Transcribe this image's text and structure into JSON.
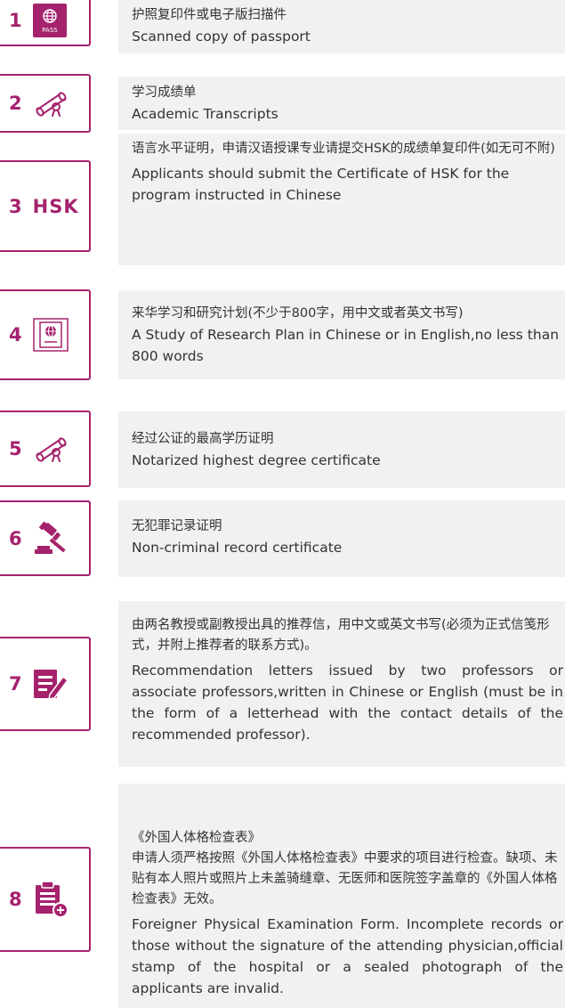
{
  "accent_color": "#a5226d",
  "items": [
    {
      "number": "1",
      "icon": "passport-icon",
      "icon_text": "PASS",
      "zh": "护照复印件或电子版扫描件",
      "en": "Scanned copy of passport"
    },
    {
      "number": "2",
      "icon": "diploma-scroll-icon",
      "zh": "学习成绩单",
      "en": "Academic Transcripts"
    },
    {
      "number": "3",
      "icon_text": "HSK",
      "zh": "语言水平证明，申请汉语授课专业请提交HSK的成绩单复印件(如无可不附)",
      "en": "Applicants should submit the Certificate of HSK for the program instructed in Chinese"
    },
    {
      "number": "4",
      "icon": "passport-book-icon",
      "zh": "来华学习和研究计划(不少于800字，用中文或者英文书写)",
      "en": "A Study of Research Plan in Chinese or in English,no less than 800 words"
    },
    {
      "number": "5",
      "icon": "diploma-scroll-icon",
      "zh": "经过公证的最高学历证明",
      "en": "Notarized highest degree certificate"
    },
    {
      "number": "6",
      "icon": "gavel-icon",
      "zh": "无犯罪记录证明",
      "en": "Non-criminal record certificate"
    },
    {
      "number": "7",
      "icon": "edit-document-icon",
      "zh": "由两名教授或副教授出具的推荐信，用中文或英文书写(必须为正式信笺形式，并附上推荐者的联系方式)。",
      "en": "Recommendation letters issued by two professors or associate professors,written in Chinese or English (must be in the form of a letterhead with the contact details of the recommended professor)."
    },
    {
      "number": "8",
      "icon": "clipboard-add-icon",
      "zh_title": "《外国人体格检查表》",
      "zh": "申请人须严格按照《外国人体格检查表》中要求的项目进行检查。缺项、未贴有本人照片或照片上未盖骑缝章、无医师和医院签字盖章的《外国人体格检查表》无效。",
      "en": "Foreigner Physical Examination Form. Incomplete records or those without the signature of the attending physician,official stamp of the hospital or a sealed photograph of the applicants are invalid."
    }
  ]
}
